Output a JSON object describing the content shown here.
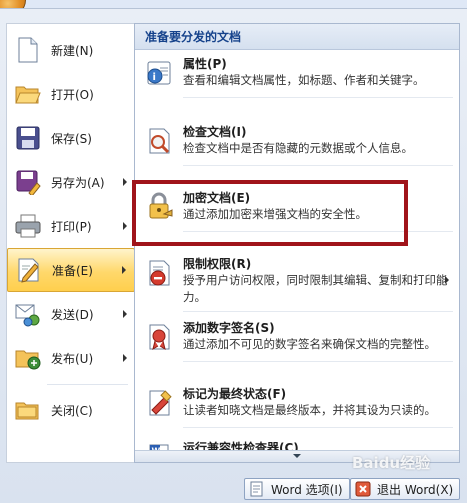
{
  "left_menu": {
    "items": [
      {
        "label": "新建(N)",
        "icon": "new-document-icon",
        "has_submenu": false
      },
      {
        "label": "打开(O)",
        "icon": "open-folder-icon",
        "has_submenu": false
      },
      {
        "label": "保存(S)",
        "icon": "save-disk-icon",
        "has_submenu": false
      },
      {
        "label": "另存为(A)",
        "icon": "save-as-icon",
        "has_submenu": true
      },
      {
        "label": "打印(P)",
        "icon": "printer-icon",
        "has_submenu": true
      },
      {
        "label": "准备(E)",
        "icon": "prepare-pen-icon",
        "has_submenu": true,
        "active": true
      },
      {
        "label": "发送(D)",
        "icon": "send-icon",
        "has_submenu": true
      },
      {
        "label": "发布(U)",
        "icon": "publish-icon",
        "has_submenu": true
      },
      {
        "label": "关闭(C)",
        "icon": "close-folder-icon",
        "has_submenu": false
      }
    ]
  },
  "panel": {
    "header": "准备要分发的文档",
    "items": [
      {
        "title": "属性(P)",
        "desc": "查看和编辑文档属性，如标题、作者和关键字。",
        "icon": "properties-icon"
      },
      {
        "title": "检查文档(I)",
        "desc": "检查文档中是否有隐藏的元数据或个人信息。",
        "icon": "inspect-document-icon"
      },
      {
        "title": "加密文档(E)",
        "desc": "通过添加加密来增强文档的安全性。",
        "icon": "encrypt-lock-icon"
      },
      {
        "title": "限制权限(R)",
        "desc": "授予用户访问权限，同时限制其编辑、复制和打印能力。",
        "icon": "restrict-permission-icon"
      },
      {
        "title": "添加数字签名(S)",
        "desc": "通过添加不可见的数字签名来确保文档的完整性。",
        "icon": "digital-signature-icon"
      },
      {
        "title": "标记为最终状态(F)",
        "desc": "让读者知晓文档是最终版本，并将其设为只读的。",
        "icon": "mark-final-icon"
      },
      {
        "title": "运行兼容性检查器(C)",
        "desc": "",
        "icon": "compatibility-checker-icon"
      }
    ]
  },
  "bottom": {
    "word_options": "Word 选项(I)",
    "exit_word": "退出 Word(X)"
  },
  "watermark": "Baidu经验",
  "colors": {
    "highlight_border": "#a0141a",
    "active_item": "#ffd86b",
    "header_text": "#15428b"
  }
}
